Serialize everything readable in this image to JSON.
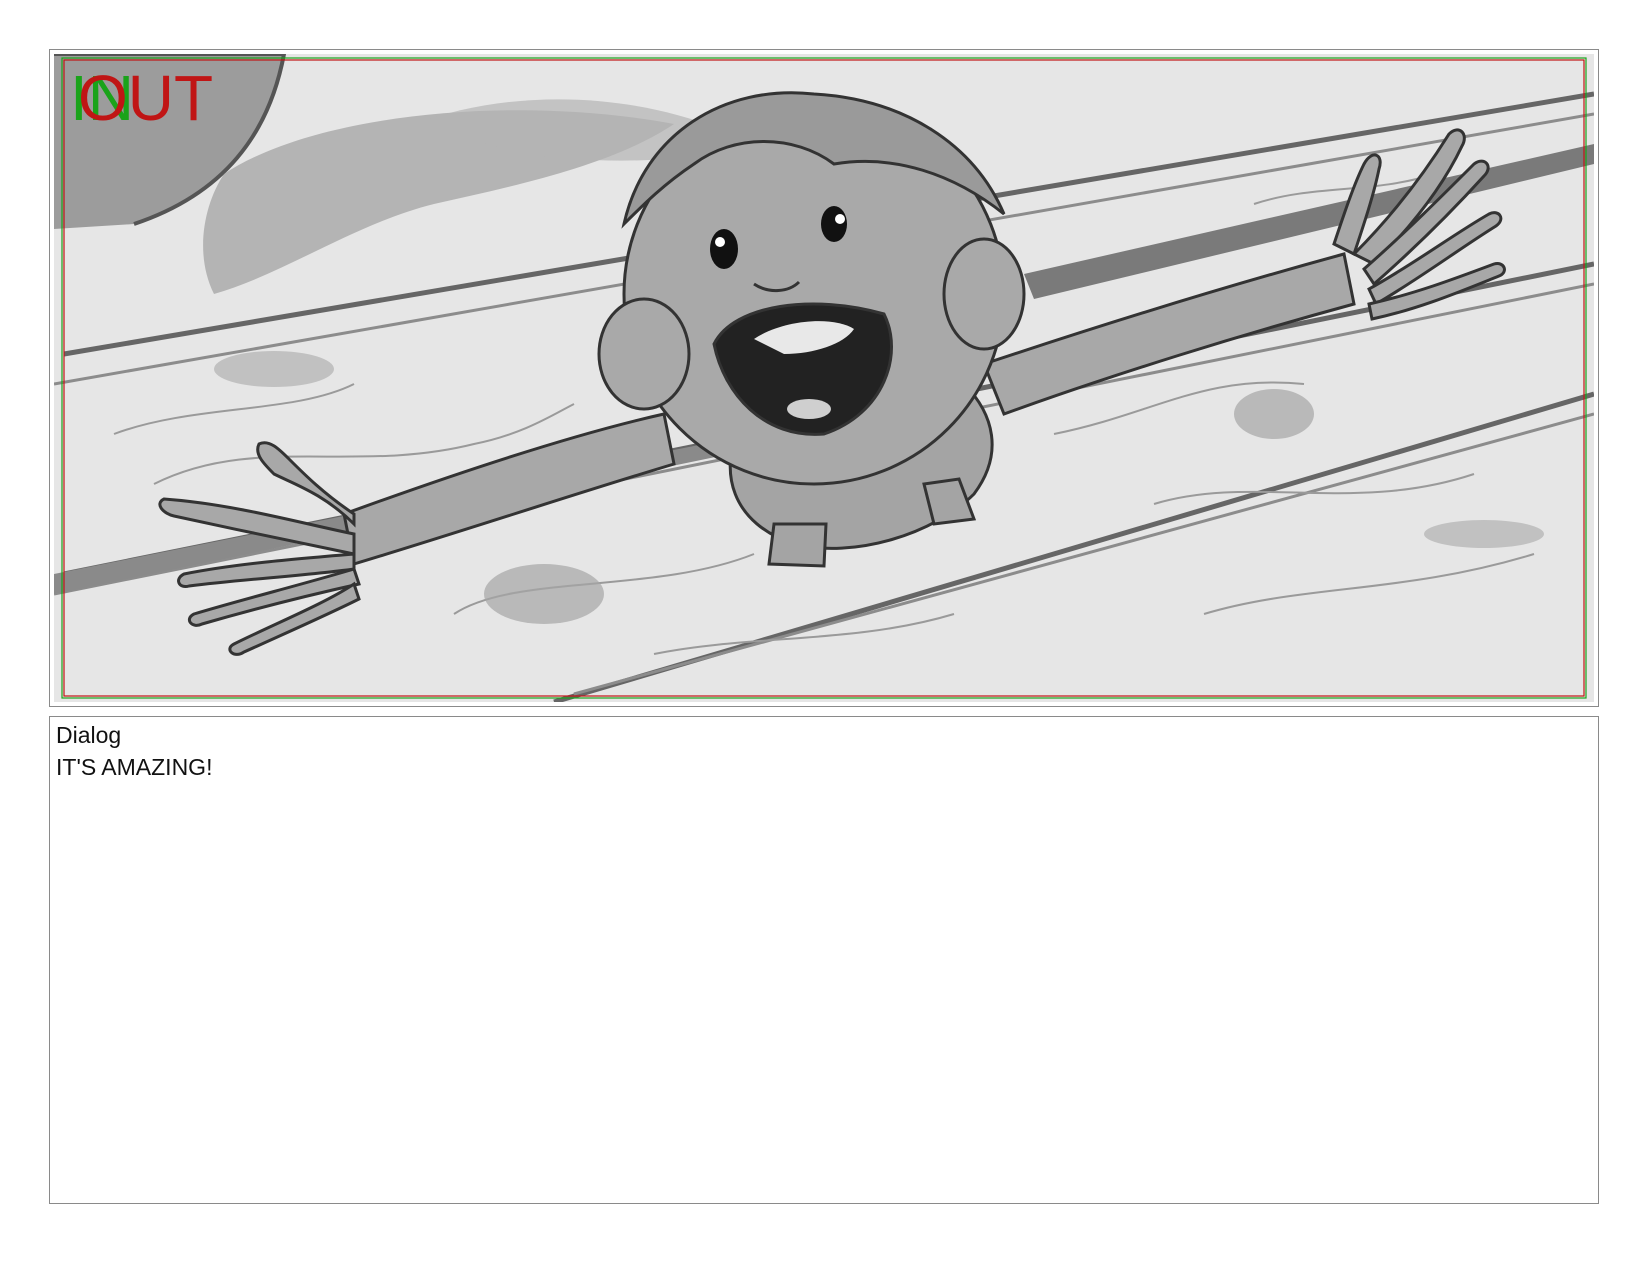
{
  "panel": {
    "in_marker": "IN",
    "out_marker": "OUT",
    "in_color": "#1aa31a",
    "out_color": "#c01515",
    "illustration": "storyboard-sketch-child-on-wooden-deck"
  },
  "dialog": {
    "label": "Dialog",
    "text": "IT'S AMAZING!"
  }
}
